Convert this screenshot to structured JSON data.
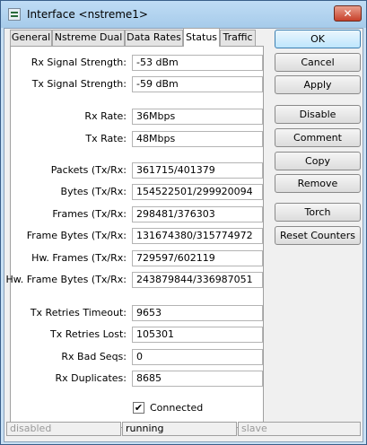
{
  "window": {
    "title": "Interface <nstreme1>",
    "close_label": "✕"
  },
  "tabs": [
    {
      "label": "General"
    },
    {
      "label": "Nstreme Dual"
    },
    {
      "label": "Data Rates"
    },
    {
      "label": "Status"
    },
    {
      "label": "Traffic"
    }
  ],
  "active_tab": "Status",
  "fields": {
    "rx_signal": {
      "label": "Rx Signal Strength:",
      "value": "-53 dBm"
    },
    "tx_signal": {
      "label": "Tx Signal Strength:",
      "value": "-59 dBm"
    },
    "rx_rate": {
      "label": "Rx Rate:",
      "value": "36Mbps"
    },
    "tx_rate": {
      "label": "Tx Rate:",
      "value": "48Mbps"
    },
    "packets": {
      "label": "Packets (Tx/Rx:",
      "value": "361715/401379"
    },
    "bytes": {
      "label": "Bytes (Tx/Rx:",
      "value": "154522501/299920094"
    },
    "frames": {
      "label": "Frames (Tx/Rx:",
      "value": "298481/376303"
    },
    "frame_bytes": {
      "label": "Frame Bytes (Tx/Rx:",
      "value": "131674380/315774972"
    },
    "hw_frames": {
      "label": "Hw. Frames (Tx/Rx:",
      "value": "729597/602119"
    },
    "hw_frame_bytes": {
      "label": "Hw. Frame Bytes (Tx/Rx:",
      "value": "243879844/336987051"
    },
    "tx_retries_timeout": {
      "label": "Tx Retries Timeout:",
      "value": "9653"
    },
    "tx_retries_lost": {
      "label": "Tx Retries Lost:",
      "value": "105301"
    },
    "rx_bad_seqs": {
      "label": "Rx Bad Seqs:",
      "value": "0"
    },
    "rx_duplicates": {
      "label": "Rx Duplicates:",
      "value": "8685"
    }
  },
  "connected": {
    "label": "Connected",
    "checked": true,
    "mark": "✔"
  },
  "buttons": {
    "ok": "OK",
    "cancel": "Cancel",
    "apply": "Apply",
    "disable": "Disable",
    "comment": "Comment",
    "copy": "Copy",
    "remove": "Remove",
    "torch": "Torch",
    "reset_counters": "Reset Counters"
  },
  "statusbar": {
    "state": "disabled",
    "running": "running",
    "slave": "slave"
  }
}
